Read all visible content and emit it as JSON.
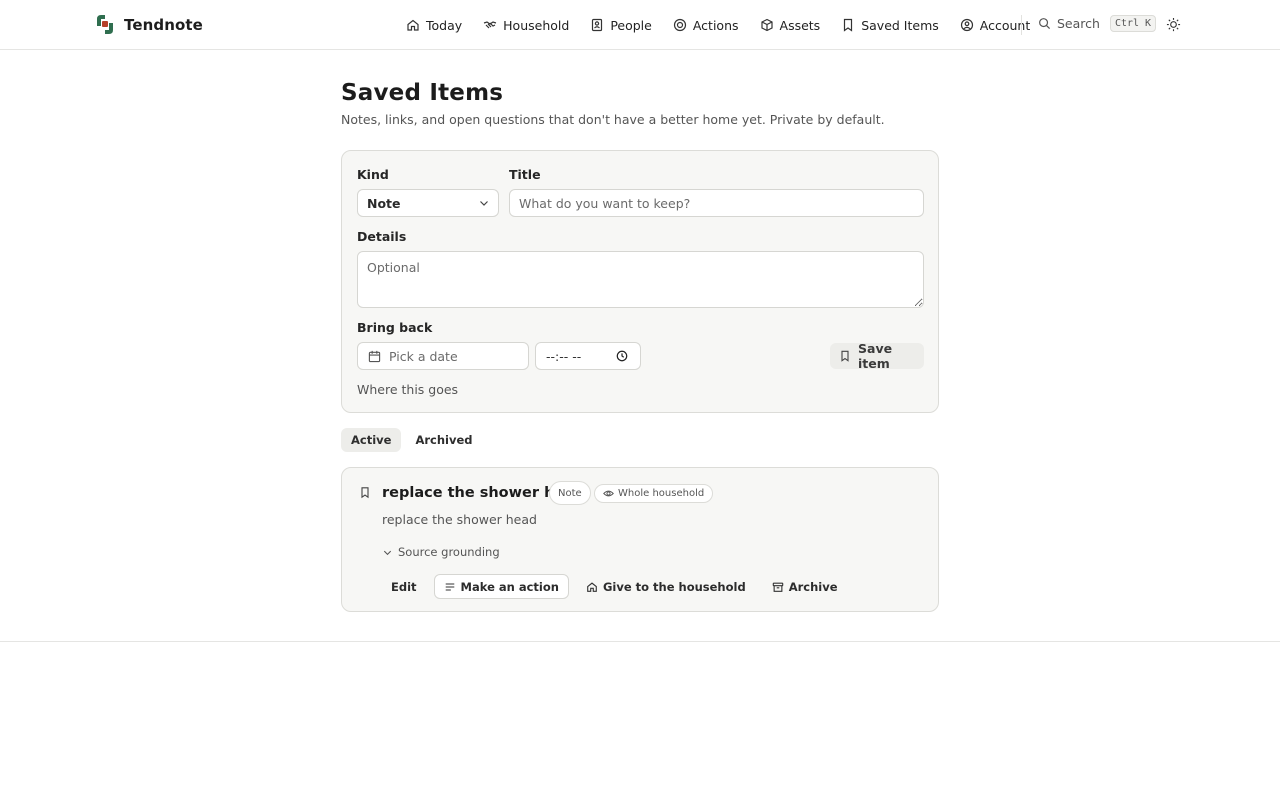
{
  "brand": {
    "name": "Tendnote",
    "colors": {
      "green": "#2f6e4f",
      "red": "#b5402a"
    }
  },
  "nav": {
    "items": [
      {
        "id": "today",
        "label": "Today",
        "icon": "home-icon"
      },
      {
        "id": "household",
        "label": "Household",
        "icon": "handshake-icon"
      },
      {
        "id": "people",
        "label": "People",
        "icon": "contacts-icon"
      },
      {
        "id": "actions",
        "label": "Actions",
        "icon": "target-icon"
      },
      {
        "id": "assets",
        "label": "Assets",
        "icon": "box-icon"
      },
      {
        "id": "saved",
        "label": "Saved Items",
        "icon": "bookmark-icon"
      },
      {
        "id": "account",
        "label": "Account",
        "icon": "user-circle-icon"
      }
    ],
    "search_label": "Search",
    "shortcut": "Ctrl K"
  },
  "page": {
    "title": "Saved Items",
    "subtitle": "Notes, links, and open questions that don't have a better home yet. Private by default."
  },
  "form": {
    "kind_label": "Kind",
    "kind_value": "Note",
    "title_label": "Title",
    "title_placeholder": "What do you want to keep?",
    "details_label": "Details",
    "details_placeholder": "Optional",
    "bring_back_label": "Bring back",
    "date_placeholder": "Pick a date",
    "time_placeholder": "--:-- --",
    "save_label": "Save item",
    "where_label": "Where this goes"
  },
  "tabs": [
    {
      "label": "Active",
      "active": true
    },
    {
      "label": "Archived",
      "active": false
    }
  ],
  "items": [
    {
      "title": "replace the shower head",
      "kind_badge": "Note",
      "scope_badge": "Whole household",
      "body": "replace the shower head",
      "grounding_label": "Source grounding",
      "actions": {
        "edit": "Edit",
        "make_action": "Make an action",
        "give": "Give to the household",
        "archive": "Archive"
      }
    }
  ]
}
